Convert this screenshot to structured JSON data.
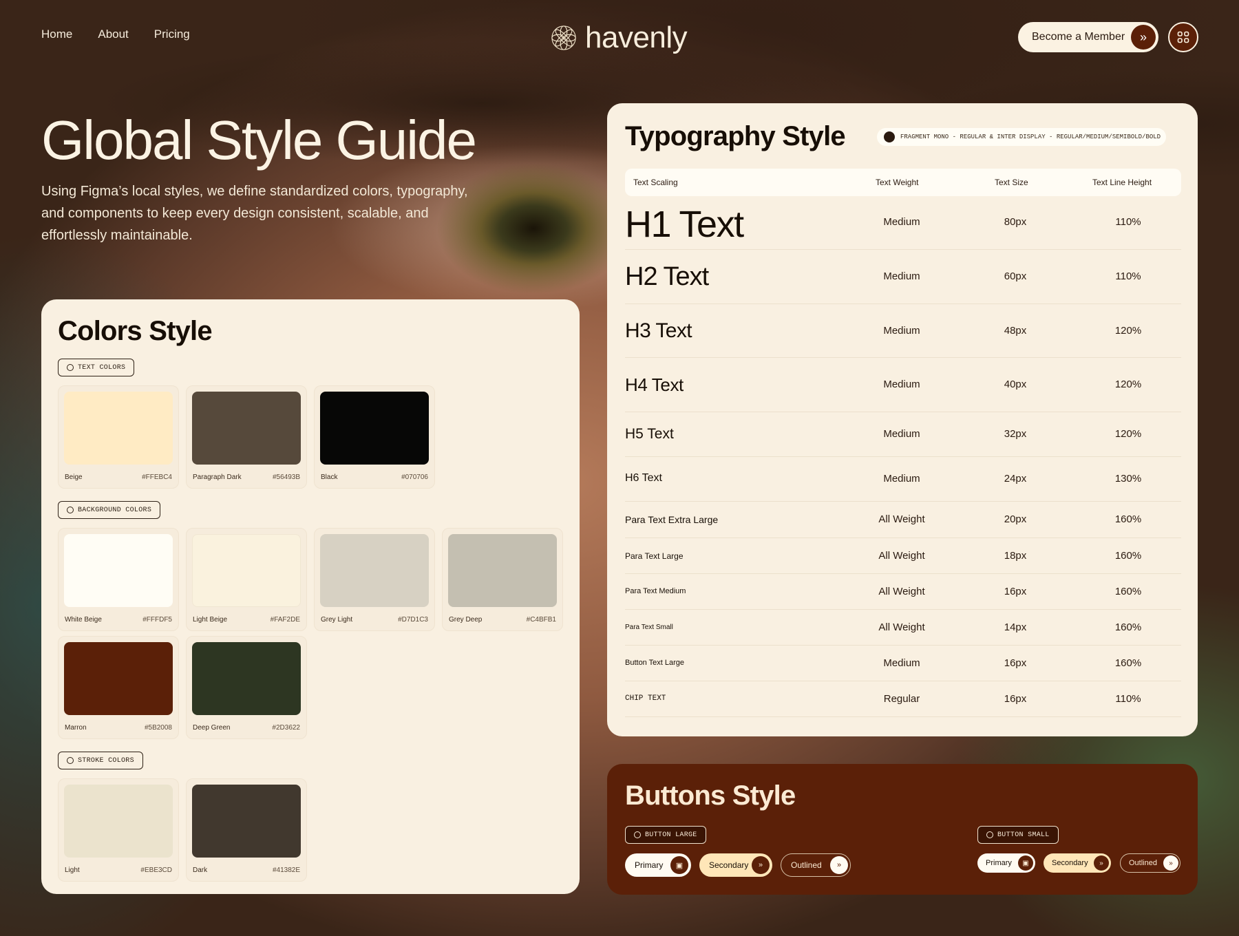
{
  "nav": {
    "items": [
      "Home",
      "About",
      "Pricing"
    ]
  },
  "brand": {
    "name": "havenly"
  },
  "header": {
    "cta_label": "Become a Member"
  },
  "hero": {
    "title": "Global Style Guide",
    "subtitle": "Using Figma’s local styles, we define standardized colors, typography, and components to keep every design consistent, scalable, and effortlessly maintainable."
  },
  "colors": {
    "title": "Colors Style",
    "text_label": "TEXT COLORS",
    "bg_label": "BACKGROUND COLORS",
    "stroke_label": "STROKE COLORS",
    "text": [
      {
        "name": "Beige",
        "hex": "#FFEBC4"
      },
      {
        "name": "Paragraph Dark",
        "hex": "#56493B"
      },
      {
        "name": "Black",
        "hex": "#070706"
      }
    ],
    "background": [
      {
        "name": "White Beige",
        "hex": "#FFFDF5"
      },
      {
        "name": "Light Beige",
        "hex": "#FAF2DE"
      },
      {
        "name": "Grey Light",
        "hex": "#D7D1C3"
      },
      {
        "name": "Grey Deep",
        "hex": "#C4BFB1"
      },
      {
        "name": "Marron",
        "hex": "#5B2008"
      },
      {
        "name": "Deep Green",
        "hex": "#2D3622"
      }
    ],
    "stroke": [
      {
        "name": "Light",
        "hex": "#EBE3CD"
      },
      {
        "name": "Dark",
        "hex": "#41382E"
      }
    ]
  },
  "typography": {
    "title": "Typography Style",
    "fonts": "FRAGMENT MONO - REGULAR & INTER DISPLAY - REGULAR/MEDIUM/SEMIBOLD/BOLD",
    "headers": [
      "Text Scaling",
      "Text Weight",
      "Text Size",
      "Text Line Height"
    ],
    "rows": [
      {
        "name": "H1 Text",
        "weight": "Medium",
        "size": "80px",
        "line": "110%"
      },
      {
        "name": "H2 Text",
        "weight": "Medium",
        "size": "60px",
        "line": "110%"
      },
      {
        "name": "H3 Text",
        "weight": "Medium",
        "size": "48px",
        "line": "120%"
      },
      {
        "name": "H4 Text",
        "weight": "Medium",
        "size": "40px",
        "line": "120%"
      },
      {
        "name": "H5 Text",
        "weight": "Medium",
        "size": "32px",
        "line": "120%"
      },
      {
        "name": "H6 Text",
        "weight": "Medium",
        "size": "24px",
        "line": "130%"
      },
      {
        "name": "Para Text Extra Large",
        "weight": "All Weight",
        "size": "20px",
        "line": "160%"
      },
      {
        "name": "Para Text Large",
        "weight": "All Weight",
        "size": "18px",
        "line": "160%"
      },
      {
        "name": "Para Text Medium",
        "weight": "All Weight",
        "size": "16px",
        "line": "160%"
      },
      {
        "name": "Para Text Small",
        "weight": "All Weight",
        "size": "14px",
        "line": "160%"
      },
      {
        "name": "Button Text Large",
        "weight": "Medium",
        "size": "16px",
        "line": "160%"
      },
      {
        "name": "CHIP TEXT",
        "weight": "Regular",
        "size": "16px",
        "line": "110%"
      }
    ]
  },
  "buttons": {
    "title": "Buttons Style",
    "large_label": "BUTTON LARGE",
    "small_label": "BUTTON SMALL",
    "primary": "Primary",
    "secondary": "Secondary",
    "outlined": "Outlined"
  }
}
